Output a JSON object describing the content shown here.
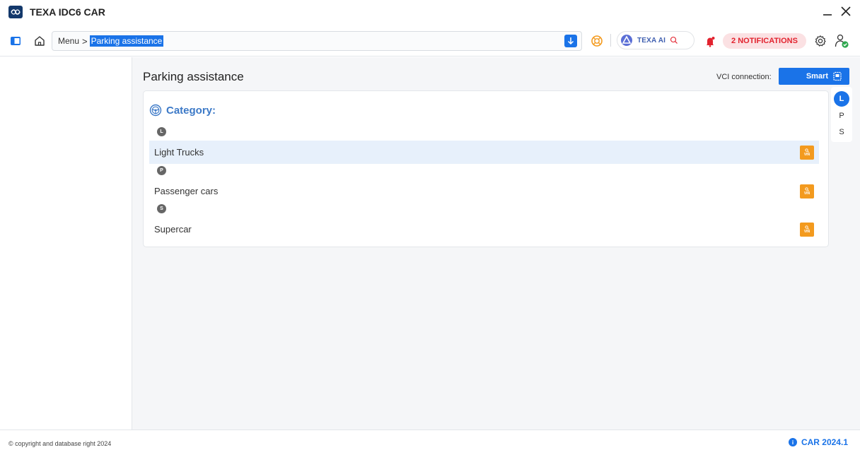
{
  "window": {
    "title": "TEXA IDC6 CAR"
  },
  "toolbar": {
    "breadcrumb_root": "Menu",
    "breadcrumb_separator": ">",
    "breadcrumb_current": "Parking assistance",
    "texa_ai_label": "TEXA AI",
    "notifications_label": "2 NOTIFICATIONS"
  },
  "main": {
    "page_title": "Parking assistance",
    "vci_label": "VCI connection:",
    "vci_button_label": "Smart",
    "category_label": "Category:",
    "groups": [
      {
        "letter": "L",
        "item": "Light Trucks",
        "selected": true
      },
      {
        "letter": "P",
        "item": "Passenger cars",
        "selected": false
      },
      {
        "letter": "S",
        "item": "Supercar",
        "selected": false
      }
    ],
    "vin_badge": "VIN",
    "alphabet_index": [
      "L",
      "P",
      "S"
    ],
    "active_letter": "L"
  },
  "footer": {
    "copyright": "© copyright and database right 2024",
    "version": "CAR 2024.1"
  },
  "colors": {
    "accent": "#1a73e8",
    "notification": "#e2232f",
    "vin_button": "#f39a1e",
    "selected_row": "#e7f0fb"
  },
  "icons": {
    "app_logo": "texa-logo-icon",
    "minimize": "minimize-icon",
    "close": "close-icon",
    "sidebar_toggle": "sidebar-toggle-icon",
    "home": "home-icon",
    "download": "arrow-down-icon",
    "help": "lifebuoy-icon",
    "ai": "texa-ai-icon",
    "search": "search-icon",
    "bell": "bell-icon",
    "settings": "gear-icon",
    "account": "user-status-icon",
    "category": "steering-wheel-icon",
    "vci": "vci-device-icon",
    "info": "info-icon"
  }
}
